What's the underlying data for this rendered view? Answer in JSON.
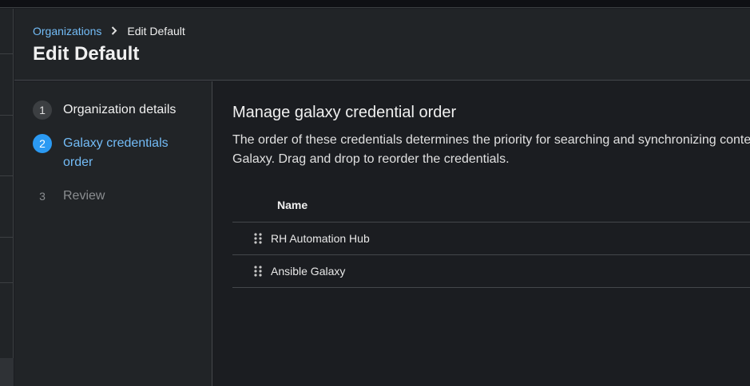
{
  "breadcrumb": {
    "parent": "Organizations",
    "current": "Edit Default"
  },
  "page": {
    "title": "Edit Default"
  },
  "wizard": {
    "steps": [
      {
        "number": "1",
        "label": "Organization details",
        "state": "completed"
      },
      {
        "number": "2",
        "label": "Galaxy credentials order",
        "state": "current"
      },
      {
        "number": "3",
        "label": "Review",
        "state": "upcoming"
      }
    ]
  },
  "main": {
    "section_title": "Manage galaxy credential order",
    "description": "The order of these credentials determines the priority for searching and synchronizing content from Galaxy. Drag and drop to reorder the credentials.",
    "table": {
      "column_header": "Name",
      "rows": [
        {
          "name": "RH Automation Hub",
          "icon": "drag-handle-icon"
        },
        {
          "name": "Ansible Galaxy",
          "icon": "drag-handle-icon"
        }
      ]
    }
  },
  "colors": {
    "link": "#73bcf7",
    "step_active": "#2b9af3",
    "background": "#1b1d21",
    "panel": "#212427"
  }
}
